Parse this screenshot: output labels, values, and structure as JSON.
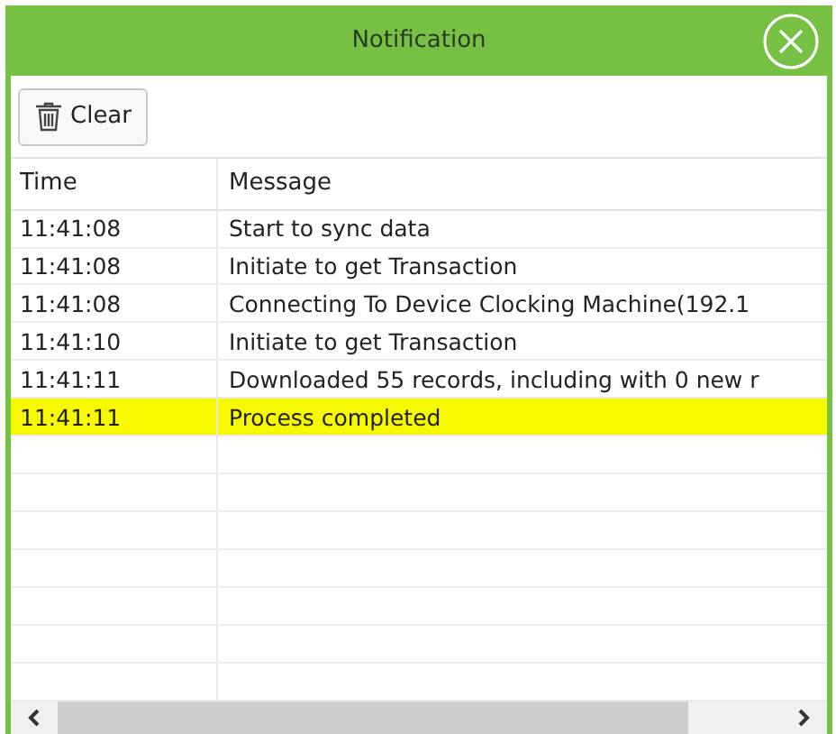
{
  "window": {
    "title": "Notification"
  },
  "toolbar": {
    "clear_button": "Clear"
  },
  "table": {
    "columns": [
      "Time",
      "Message"
    ],
    "rows": [
      {
        "time": "11:41:08",
        "message": "Start to sync data",
        "highlighted": false
      },
      {
        "time": "11:41:08",
        "message": "Initiate to get Transaction",
        "highlighted": false
      },
      {
        "time": "11:41:08",
        "message": "Connecting To Device Clocking Machine(192.1",
        "highlighted": false
      },
      {
        "time": "11:41:10",
        "message": "Initiate to get Transaction",
        "highlighted": false
      },
      {
        "time": "11:41:11",
        "message": "Downloaded 55 records, including with 0 new r",
        "highlighted": false
      },
      {
        "time": "11:41:11",
        "message": "Process completed",
        "highlighted": true
      }
    ]
  }
}
